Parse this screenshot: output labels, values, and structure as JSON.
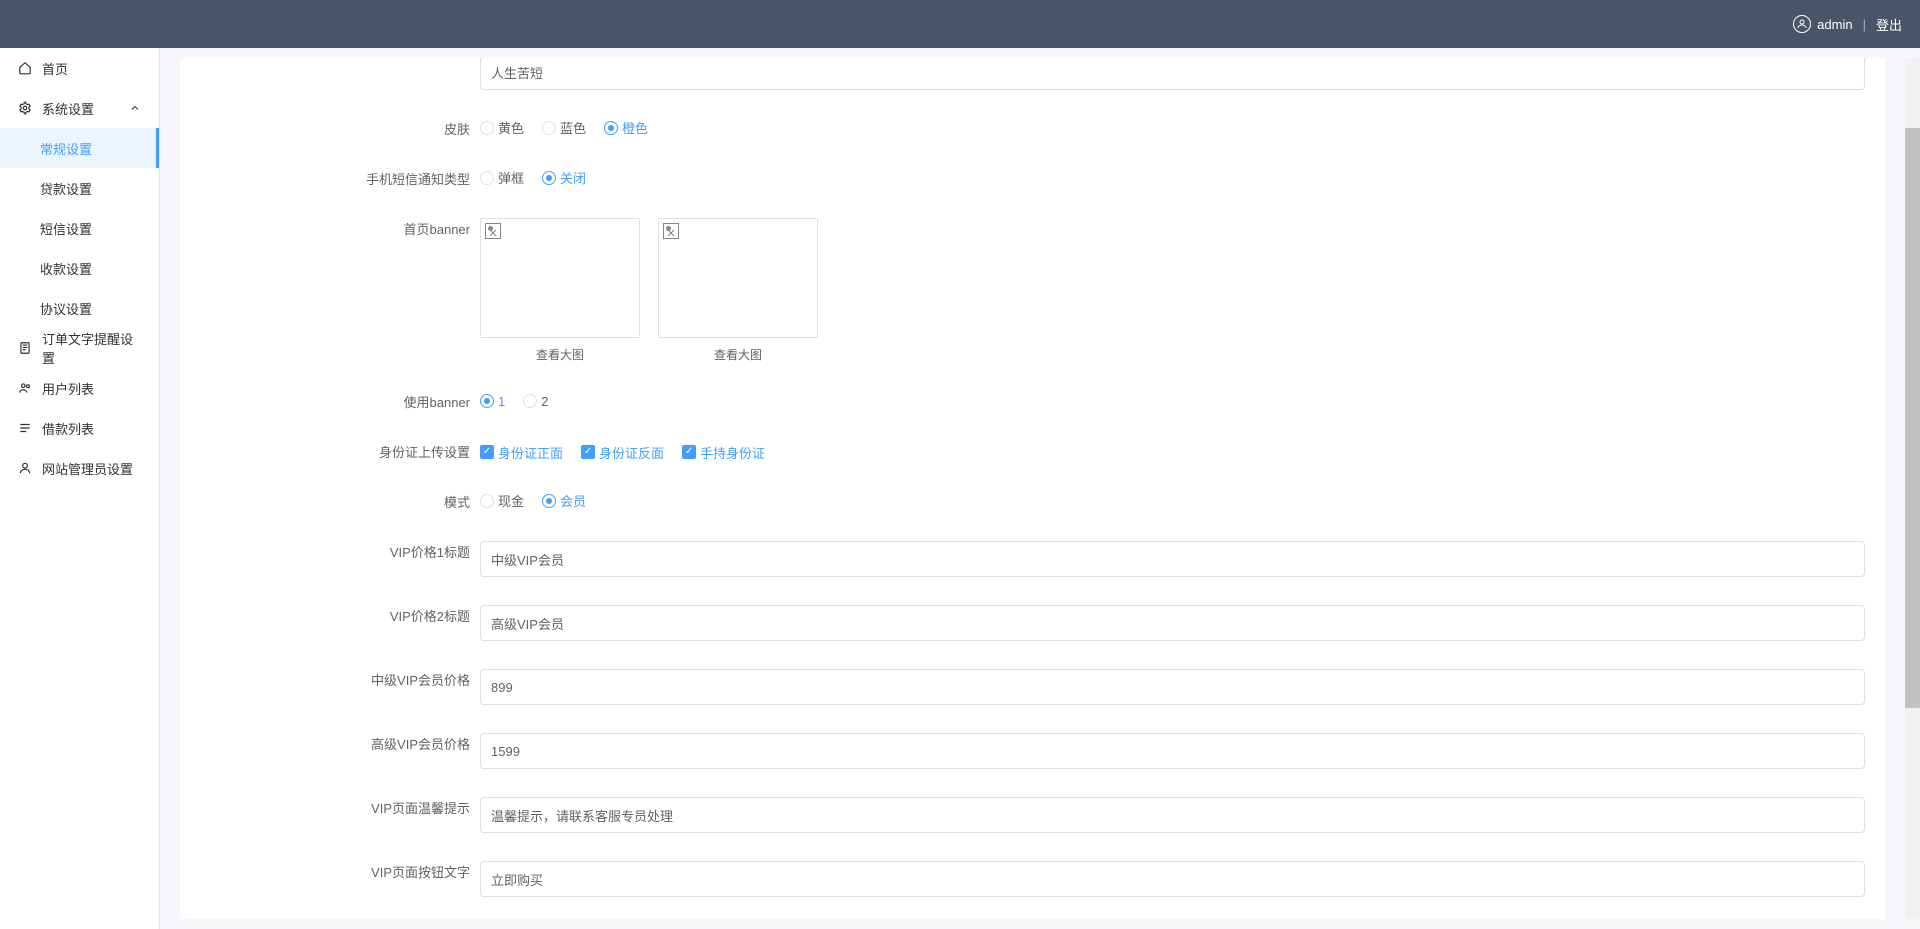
{
  "header": {
    "username": "admin",
    "logout": "登出"
  },
  "sidebar": {
    "home": "首页",
    "system": {
      "label": "系统设置",
      "expanded": true
    },
    "system_children": {
      "general": "常规设置",
      "loan": "贷款设置",
      "sms": "短信设置",
      "collect": "收款设置",
      "agreement": "协议设置"
    },
    "order_text": "订单文字提醒设置",
    "user_list": "用户列表",
    "loan_list": "借款列表",
    "admin": "网站管理员设置"
  },
  "form": {
    "hidden_input_value": "人生苦短",
    "skin": {
      "label": "皮肤",
      "yellow": "黄色",
      "blue": "蓝色",
      "orange": "橙色",
      "selected": "orange"
    },
    "sms_type": {
      "label": "手机短信通知类型",
      "popup": "弹框",
      "close": "关闭",
      "selected": "close"
    },
    "banner": {
      "label": "首页banner",
      "view": "查看大图"
    },
    "use_banner": {
      "label": "使用banner",
      "opt1": "1",
      "opt2": "2",
      "selected": "1"
    },
    "id_upload": {
      "label": "身份证上传设置",
      "front": "身份证正面",
      "back": "身份证反面",
      "hand": "手持身份证"
    },
    "mode": {
      "label": "模式",
      "cash": "现金",
      "member": "会员",
      "selected": "member"
    },
    "vip1_title": {
      "label": "VIP价格1标题",
      "value": "中级VIP会员"
    },
    "vip2_title": {
      "label": "VIP价格2标题",
      "value": "高级VIP会员"
    },
    "mid_vip_price": {
      "label": "中级VIP会员价格",
      "value": "899"
    },
    "high_vip_price": {
      "label": "高级VIP会员价格",
      "value": "1599"
    },
    "vip_tip": {
      "label": "VIP页面温馨提示",
      "value": "温馨提示，请联系客服专员处理"
    },
    "vip_btn": {
      "label": "VIP页面按钮文字",
      "value": "立即购买"
    }
  }
}
